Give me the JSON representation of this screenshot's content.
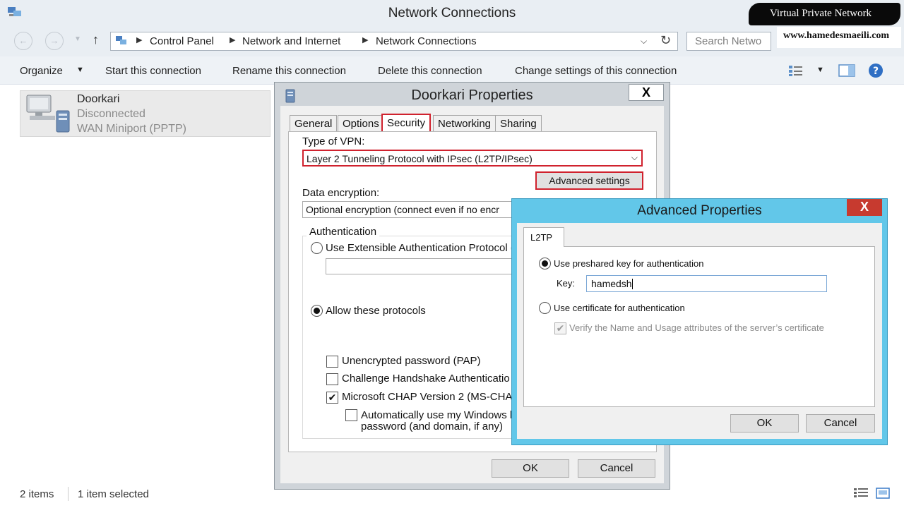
{
  "window": {
    "title": "Network Connections"
  },
  "watermark": {
    "title": "Virtual Private Network",
    "url": "www.hamedesmaeili.com"
  },
  "address": {
    "crumbs": [
      "Control Panel",
      "Network and Internet",
      "Network Connections"
    ],
    "search_placeholder": "Search Netwo"
  },
  "toolbar": {
    "organize": "Organize",
    "start": "Start this connection",
    "rename": "Rename this connection",
    "delete": "Delete this connection",
    "change": "Change settings of this connection"
  },
  "connection": {
    "name": "Doorkari",
    "status": "Disconnected",
    "device": "WAN Miniport (PPTP)"
  },
  "statusbar": {
    "items": "2 items",
    "selected": "1 item selected"
  },
  "props": {
    "title": "Doorkari Properties",
    "close": "X",
    "tabs": [
      "General",
      "Options",
      "Security",
      "Networking",
      "Sharing"
    ],
    "active_tab": "Security",
    "vpn_type_label": "Type of VPN:",
    "vpn_type_value": "Layer 2 Tunneling Protocol with IPsec (L2TP/IPsec)",
    "advanced_button": "Advanced settings",
    "encryption_label": "Data encryption:",
    "encryption_value": "Optional encryption (connect even if no encr",
    "auth_label": "Authentication",
    "eap_label": "Use Extensible Authentication Protocol (",
    "allow_label": "Allow these protocols",
    "pap_label": "Unencrypted password (PAP)",
    "chap_label": "Challenge Handshake Authenticatio",
    "mschap_label": "Microsoft CHAP Version 2 (MS-CHA",
    "auto_label_1": "Automatically use my Windows l",
    "auto_label_2": "password (and domain, if any)",
    "ok": "OK",
    "cancel": "Cancel"
  },
  "advanced": {
    "title": "Advanced Properties",
    "close": "X",
    "tab": "L2TP",
    "psk_label": "Use preshared key for authentication",
    "key_label": "Key:",
    "key_value": "hamedsh",
    "cert_label": "Use certificate for authentication",
    "verify_label": "Verify the Name and Usage attributes of the server’s certificate",
    "ok": "OK",
    "cancel": "Cancel"
  },
  "colors": {
    "highlight": "#d0222e",
    "dialog_accent": "#62c7e9",
    "close_red": "#c73a2f"
  }
}
